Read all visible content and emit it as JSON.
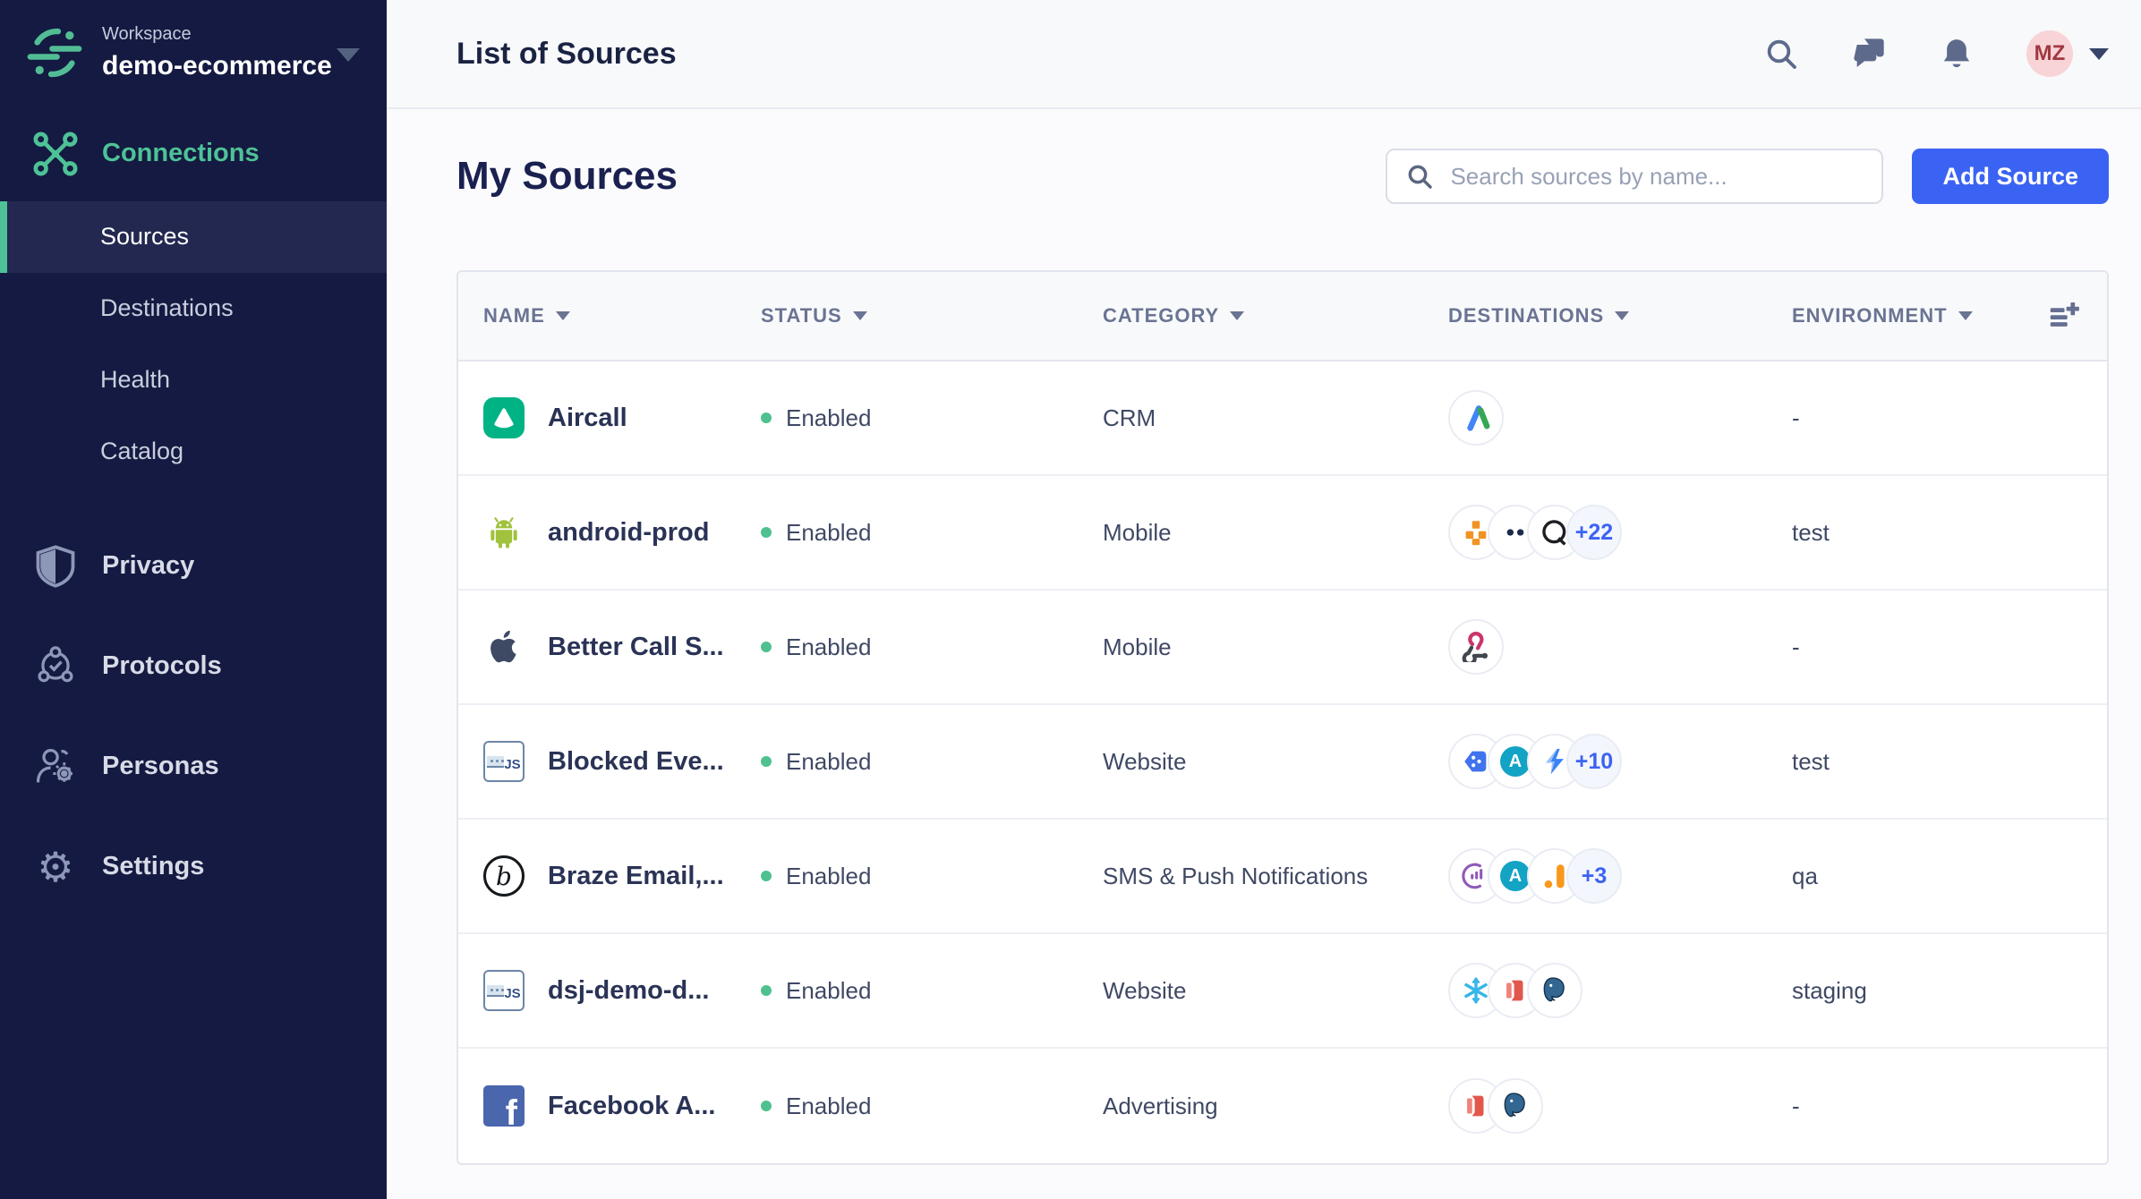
{
  "workspace": {
    "label": "Workspace",
    "name": "demo-ecommerce"
  },
  "header": {
    "title": "List of Sources",
    "avatar_initials": "MZ"
  },
  "sidebar": {
    "connections": {
      "label": "Connections",
      "icon": "connections-icon"
    },
    "sub_items": [
      "Sources",
      "Destinations",
      "Health",
      "Catalog"
    ],
    "active_item": "Sources",
    "sections": [
      {
        "label": "Privacy",
        "icon": "shield-icon"
      },
      {
        "label": "Protocols",
        "icon": "protocols-icon"
      },
      {
        "label": "Personas",
        "icon": "personas-icon"
      },
      {
        "label": "Settings",
        "icon": "gear-icon"
      }
    ]
  },
  "main": {
    "title": "My Sources",
    "search_placeholder": "Search sources by name...",
    "add_button": "Add Source"
  },
  "table": {
    "columns": [
      "NAME",
      "STATUS",
      "CATEGORY",
      "DESTINATIONS",
      "ENVIRONMENT"
    ],
    "rows": [
      {
        "name": "Aircall",
        "icon": "aircall",
        "status": "Enabled",
        "category": "CRM",
        "destinations": [
          "google-adwords"
        ],
        "more": "",
        "environment": "-"
      },
      {
        "name": "android-prod",
        "icon": "android",
        "status": "Enabled",
        "category": "Mobile",
        "destinations": [
          "aws",
          "dots-logo",
          "mono-circle"
        ],
        "more": "+22",
        "environment": "test"
      },
      {
        "name": "Better Call S...",
        "icon": "apple",
        "status": "Enabled",
        "category": "Mobile",
        "destinations": [
          "webhook"
        ],
        "more": "",
        "environment": "-"
      },
      {
        "name": "Blocked Eve...",
        "icon": "javascript",
        "status": "Enabled",
        "category": "Website",
        "destinations": [
          "blue-chevron",
          "teal-a",
          "lightning"
        ],
        "more": "+10",
        "environment": "test"
      },
      {
        "name": "Braze Email,...",
        "icon": "braze",
        "status": "Enabled",
        "category": "SMS & Push Notifications",
        "destinations": [
          "purple-meter",
          "teal-a",
          "google-analytics"
        ],
        "more": "+3",
        "environment": "qa"
      },
      {
        "name": "dsj-demo-d...",
        "icon": "javascript",
        "status": "Enabled",
        "category": "Website",
        "destinations": [
          "snowflake",
          "redshift",
          "postgres"
        ],
        "more": "",
        "environment": "staging"
      },
      {
        "name": "Facebook A...",
        "icon": "facebook",
        "status": "Enabled",
        "category": "Advertising",
        "destinations": [
          "redshift",
          "postgres"
        ],
        "more": "",
        "environment": "-"
      }
    ]
  },
  "colors": {
    "accent_green": "#4EC296",
    "primary_blue": "#3B63F3",
    "sidebar_bg": "#141A41",
    "status_green": "#4FC08F"
  }
}
